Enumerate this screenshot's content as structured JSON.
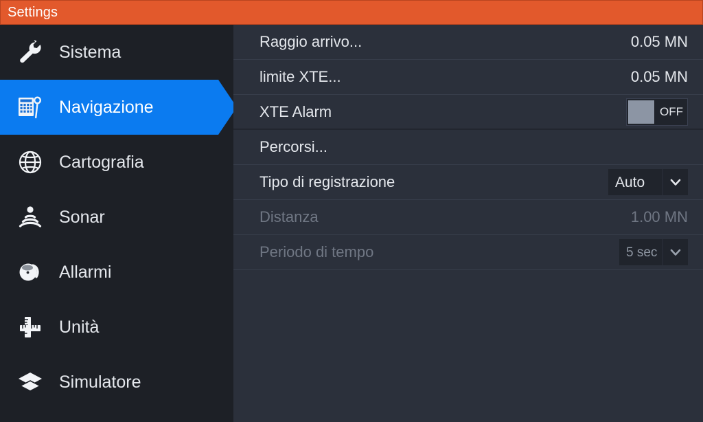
{
  "titlebar": {
    "title": "Settings",
    "accent_color": "#e2592c"
  },
  "sidebar": {
    "background_color": "#1d2026",
    "selected_color": "#0b7bf0",
    "items": [
      {
        "label": "Sistema",
        "icon": "wrench-icon",
        "selected": false
      },
      {
        "label": "Navigazione",
        "icon": "chart-plot-icon",
        "selected": true
      },
      {
        "label": "Cartografia",
        "icon": "globe-icon",
        "selected": false
      },
      {
        "label": "Sonar",
        "icon": "sonar-icon",
        "selected": false
      },
      {
        "label": "Allarmi",
        "icon": "bell-icon",
        "selected": false
      },
      {
        "label": "Unità",
        "icon": "ruler-icon",
        "selected": false
      },
      {
        "label": "Simulatore",
        "icon": "layers-icon",
        "selected": false
      }
    ]
  },
  "panel": {
    "background_color": "#2b303b",
    "rows": [
      {
        "label": "Raggio arrivo...",
        "value": "0.05 MN",
        "type": "value",
        "disabled": false
      },
      {
        "label": "limite XTE...",
        "value": "0.05 MN",
        "type": "value",
        "disabled": false
      },
      {
        "label": "XTE Alarm",
        "value": "OFF",
        "type": "toggle",
        "disabled": false,
        "toggle_on": false
      },
      {
        "label": "Percorsi...",
        "value": "",
        "type": "link",
        "disabled": false
      },
      {
        "label": "Tipo di registrazione",
        "value": "Auto",
        "type": "dropdown",
        "disabled": false
      },
      {
        "label": "Distanza",
        "value": "1.00 MN",
        "type": "value",
        "disabled": true
      },
      {
        "label": "Periodo di tempo",
        "value": "5 sec",
        "type": "dropdown",
        "disabled": true
      }
    ]
  }
}
